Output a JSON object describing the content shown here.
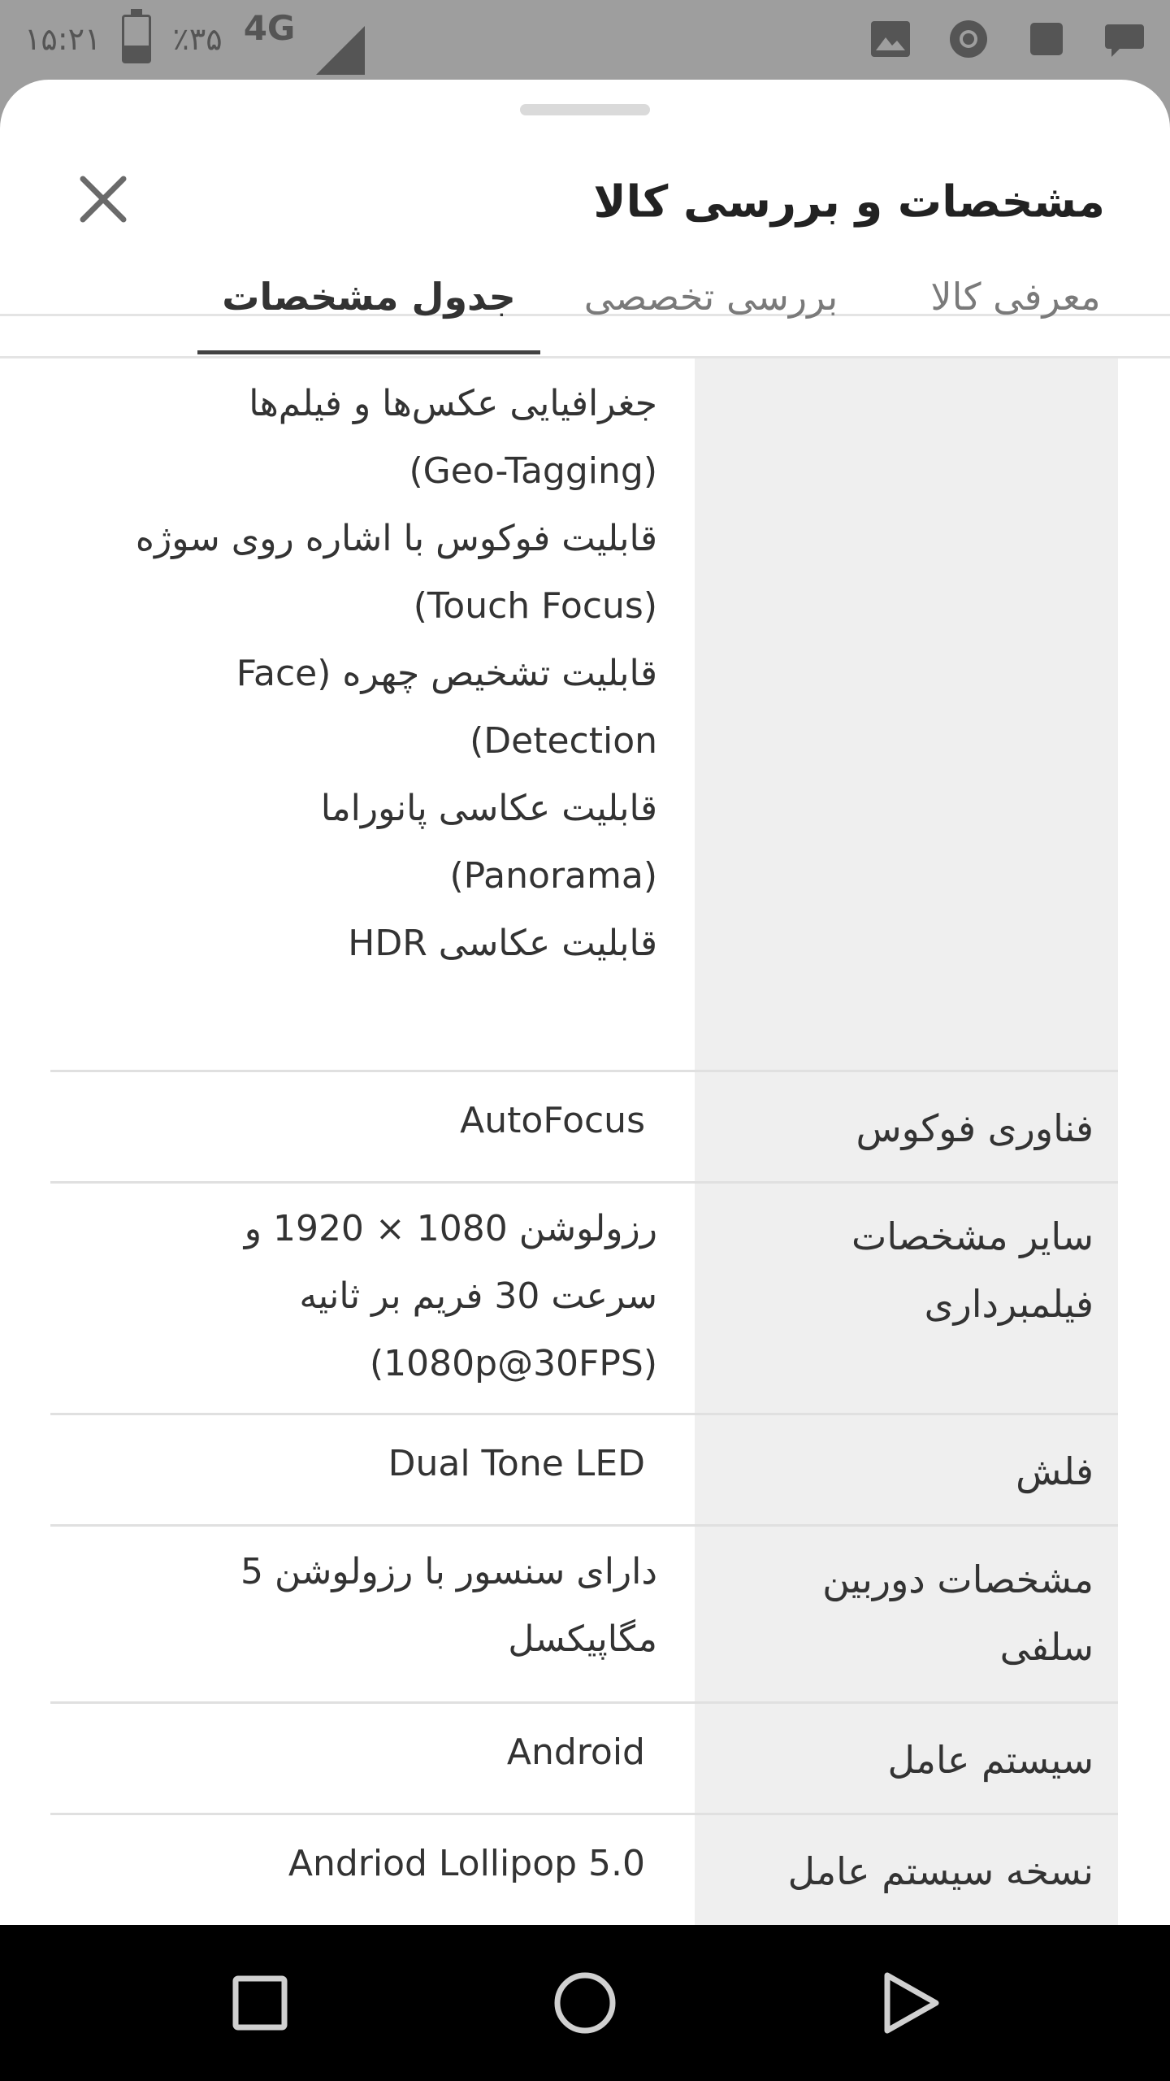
{
  "status_bar": {
    "time": "۱۵:۲۱",
    "battery_text": "٪۳۵",
    "battery_level": 0.35,
    "network": "4G",
    "icons": [
      "image-icon",
      "chrome-icon",
      "square-notification-icon",
      "chat-bubble-icon"
    ]
  },
  "sheet": {
    "title": "مشخصات و بررسی کالا",
    "close_icon": "close-icon"
  },
  "tabs": [
    {
      "label": "معرفی کالا",
      "active": false
    },
    {
      "label": "بررسی تخصصی",
      "active": false
    },
    {
      "label": "جدول مشخصات",
      "active": true
    }
  ],
  "spec_rows": [
    {
      "label": [],
      "value": [
        "جغرافیایی عکس‌ها و فیلم‌ها",
        "(Geo-Tagging)",
        "قابلیت فوکوس با اشاره روی سوژه",
        "(Touch Focus)",
        "قابلیت تشخیص چهره (Face",
        "Detection)",
        "قابلیت عکاسی پانوراما",
        "(Panorama)",
        "قابلیت عکاسی HDR"
      ]
    },
    {
      "label": [
        "فناوری فوکوس"
      ],
      "value": [
        "AutoFocus"
      ]
    },
    {
      "label": [
        "سایر مشخصات",
        "فیلمبرداری"
      ],
      "value": [
        "رزولوشن 1080 × 1920 و",
        "سرعت 30 فریم بر ثانیه",
        "(1080p@30FPS)"
      ]
    },
    {
      "label": [
        "فلش"
      ],
      "value": [
        "Dual Tone LED"
      ]
    },
    {
      "label": [
        "مشخصات دوربین",
        "سلفی"
      ],
      "value": [
        "دارای سنسور با رزولوشن 5",
        "مگاپیکسل"
      ]
    },
    {
      "label": [
        "سیستم عامل"
      ],
      "value": [
        "Android"
      ]
    },
    {
      "label": [
        "نسخه سیستم عامل"
      ],
      "value": [
        "Andriod Lollipop 5.0"
      ]
    }
  ],
  "nav_bar": {
    "buttons": [
      "recents-icon",
      "home-icon",
      "back-icon"
    ]
  },
  "colors": {
    "status_bar_bg": "#9e9e9e",
    "sheet_bg": "#ffffff",
    "label_col_bg": "#efefef",
    "tab_indicator": "#424242",
    "nav_bar_bg": "#000000"
  }
}
